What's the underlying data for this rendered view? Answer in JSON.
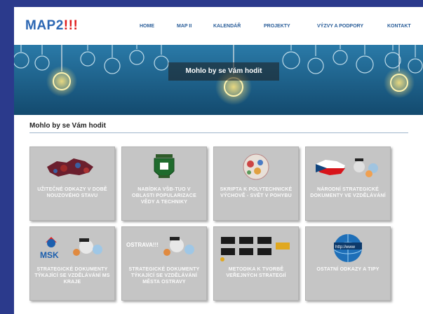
{
  "site": {
    "logo": "MAP2",
    "logo_exclaim": "!!!"
  },
  "nav": [
    {
      "label": "HOME"
    },
    {
      "label": "MAP II"
    },
    {
      "label": "KALENDÁŘ"
    },
    {
      "label": "PROJEKTY"
    },
    {
      "label": "VÝZVY A PODPORY"
    },
    {
      "label": "KONTAKT"
    }
  ],
  "banner": {
    "title": "Mohlo by se Vám hodit"
  },
  "section": {
    "title": "Mohlo by se Vám hodit"
  },
  "cards": [
    {
      "label": "UŽITEČNÉ ODKAZY V DOBĚ NOUZOVÉHO STAVU",
      "icon": "covid-map-icon"
    },
    {
      "label": "NABÍDKA VŠB-TUO V OBLASTI POPULARIZACE VĚDY A TECHNIKY",
      "icon": "vsb-tuo-emblem-icon"
    },
    {
      "label": "SKRIPTA K POLYTECHNICKÉ VÝCHOVĚ - SVĚT V POHYBU",
      "icon": "svet-v-pohybu-icon"
    },
    {
      "label": "NÁRODNÍ STRATEGICKÉ DOKUMENTY VE VZDĚLÁVÁNÍ",
      "icon": "czech-flag-map-icon"
    },
    {
      "label": "STRATEGICKÉ DOKUMENTY TÝKAJÍCÍ SE VZDĚLÁVÁNÍ MS KRAJE",
      "icon": "msk-logo-icon",
      "brand": "MSK"
    },
    {
      "label": "STRATEGICKÉ DOKUMENTY TÝKAJÍCÍ SE VZDĚLÁVÁNÍ MĚSTA OSTRAVY",
      "icon": "ostrava-logo-icon",
      "brand": "OSTRAVA!!!"
    },
    {
      "label": "METODIKA K TVORBĚ VEŘEJNÝCH STRATEGIÍ",
      "icon": "flowchart-icon"
    },
    {
      "label": "OSTATNÍ ODKAZY A TIPY",
      "icon": "www-globe-icon",
      "brand": "http://www"
    }
  ],
  "colors": {
    "brand_blue": "#2c67b3",
    "brand_red": "#e01d1d",
    "banner_bg": "#1d5e87",
    "card_bg": "#c5c5c5",
    "page_border": "#2b3a8c"
  }
}
